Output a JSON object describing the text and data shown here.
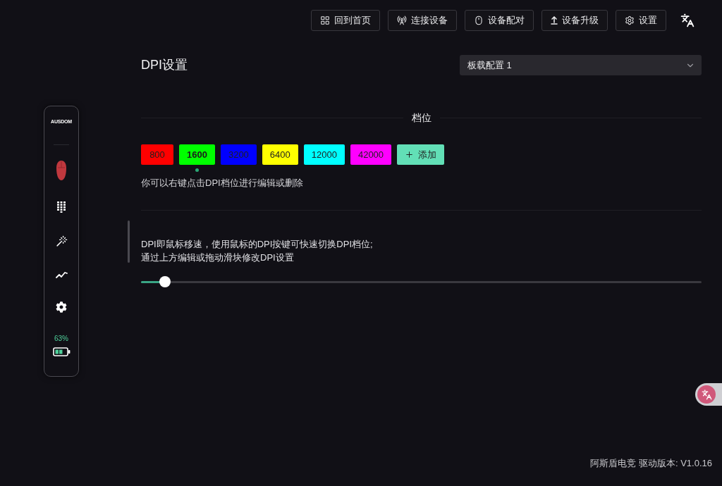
{
  "toolbar": {
    "buttons": [
      {
        "label": "回到首页"
      },
      {
        "label": "连接设备"
      },
      {
        "label": "设备配对"
      },
      {
        "label": "设备升级"
      },
      {
        "label": "设置"
      }
    ]
  },
  "sidebar": {
    "logo": "AUSDOM",
    "battery_text": "63%"
  },
  "dpi_settings": {
    "title": "DPI设置",
    "profile_select": {
      "value": "板载配置 1"
    },
    "section_heading": "档位",
    "levels": [
      {
        "label": "800",
        "color": "#ff0000",
        "selected": false
      },
      {
        "label": "1600",
        "color": "#00ff00",
        "selected": true
      },
      {
        "label": "3200",
        "color": "#0000ff",
        "selected": false
      },
      {
        "label": "6400",
        "color": "#ffff00",
        "selected": false
      },
      {
        "label": "12000",
        "color": "#00ffff",
        "selected": false
      },
      {
        "label": "42000",
        "color": "#ff00ff",
        "selected": false
      }
    ],
    "add_button": {
      "label": "添加"
    },
    "hint": "你可以右键点击DPI档位进行编辑或删除",
    "description": [
      "DPI即鼠标移速，使用鼠标的DPI按键可快速切换DPI档位;",
      "通过上方编辑或拖动滑块修改DPI设置"
    ],
    "slider": {
      "level": 0.043
    }
  },
  "footer": {
    "version": "阿斯盾电竞 驱动版本: V1.0.16"
  }
}
